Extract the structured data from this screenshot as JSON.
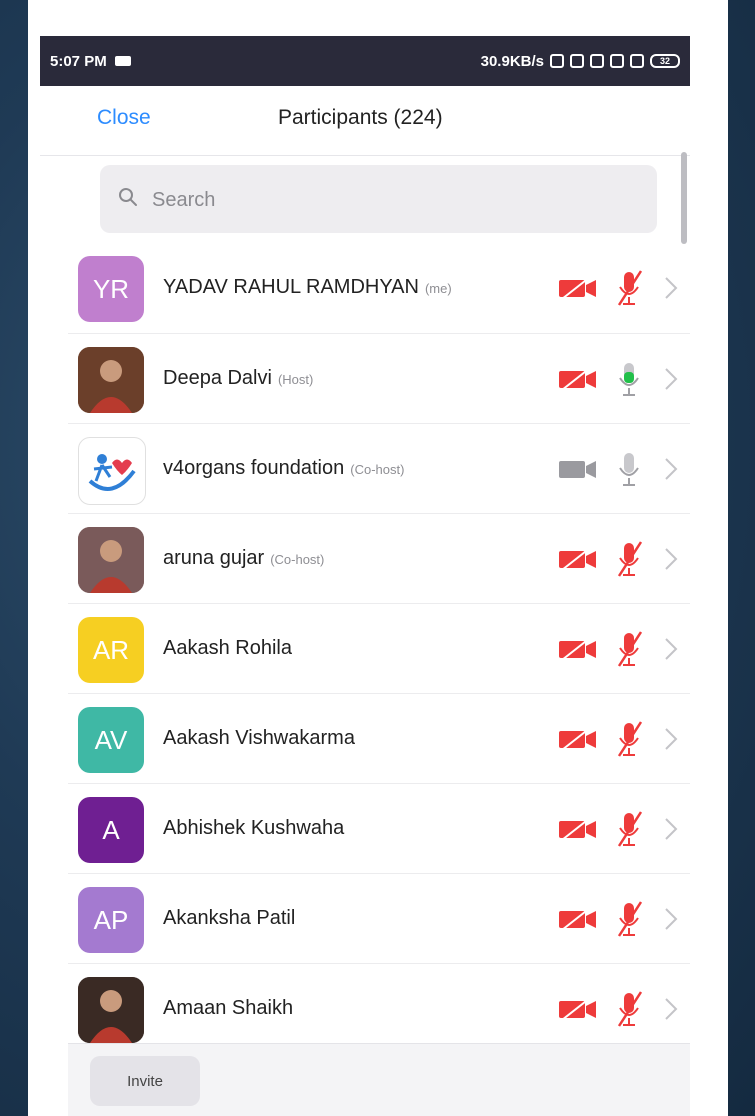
{
  "status_bar": {
    "time": "5:07 PM",
    "network_speed": "30.9KB/s",
    "battery": "32"
  },
  "header": {
    "close_label": "Close",
    "title": "Participants (224)"
  },
  "search": {
    "placeholder": "Search"
  },
  "colors": {
    "accent": "#2d8cff",
    "muted_red": "#ee3b3b",
    "active_green": "#22c04a",
    "inactive_gray": "#9a9a9f"
  },
  "participants": [
    {
      "initials": "YR",
      "avatar_color": "#c07fce",
      "avatar_type": "initials",
      "name": "YADAV RAHUL RAMDHYAN",
      "role": "(me)",
      "video": "off",
      "audio": "muted"
    },
    {
      "initials": "",
      "avatar_color": "#6b3f2a",
      "avatar_type": "photo",
      "name": "Deepa Dalvi",
      "role": "(Host)",
      "video": "off",
      "audio": "active"
    },
    {
      "initials": "",
      "avatar_color": "#ffffff",
      "avatar_type": "logo",
      "name": "v4organs foundation",
      "role": "(Co-host)",
      "video": "on",
      "audio": "unmuted"
    },
    {
      "initials": "",
      "avatar_color": "#7a5a5a",
      "avatar_type": "photo",
      "name": "aruna gujar",
      "role": "(Co-host)",
      "video": "off",
      "audio": "muted"
    },
    {
      "initials": "AR",
      "avatar_color": "#f6cf22",
      "avatar_type": "initials",
      "name": "Aakash Rohila",
      "role": "",
      "video": "off",
      "audio": "muted"
    },
    {
      "initials": "AV",
      "avatar_color": "#3fb8a5",
      "avatar_type": "initials",
      "name": "Aakash Vishwakarma",
      "role": "",
      "video": "off",
      "audio": "muted"
    },
    {
      "initials": "A",
      "avatar_color": "#6f1f92",
      "avatar_type": "initials",
      "name": "Abhishek Kushwaha",
      "role": "",
      "video": "off",
      "audio": "muted"
    },
    {
      "initials": "AP",
      "avatar_color": "#a47ad0",
      "avatar_type": "initials",
      "name": "Akanksha Patil",
      "role": "",
      "video": "off",
      "audio": "muted"
    },
    {
      "initials": "",
      "avatar_color": "#3a2a24",
      "avatar_type": "photo",
      "name": "Amaan Shaikh",
      "role": "",
      "video": "off",
      "audio": "muted"
    }
  ],
  "footer": {
    "invite_label": "Invite"
  }
}
